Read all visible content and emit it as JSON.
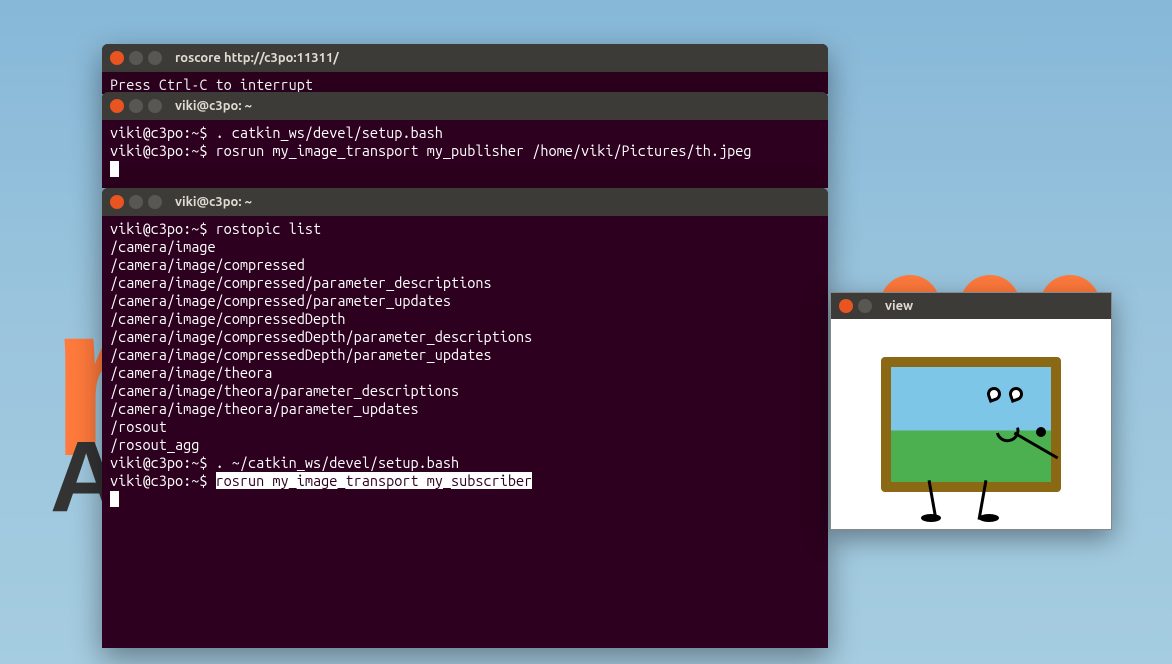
{
  "desktop": {
    "bg_text_top": "r",
    "bg_text_bottom": "A"
  },
  "term1": {
    "title": "roscore http://c3po:11311/",
    "line1": "Press Ctrl-C to interrupt"
  },
  "term2": {
    "title": "viki@c3po: ~",
    "prompt": "viki@c3po:~$ ",
    "line1_cmd": ". catkin_ws/devel/setup.bash",
    "line2_cmd": "rosrun my_image_transport my_publisher /home/viki/Pictures/th.jpeg"
  },
  "term3": {
    "title": "viki@c3po: ~",
    "prompt": "viki@c3po:~$ ",
    "line1_cmd": "rostopic list",
    "topics": [
      "/camera/image",
      "/camera/image/compressed",
      "/camera/image/compressed/parameter_descriptions",
      "/camera/image/compressed/parameter_updates",
      "/camera/image/compressedDepth",
      "/camera/image/compressedDepth/parameter_descriptions",
      "/camera/image/compressedDepth/parameter_updates",
      "/camera/image/theora",
      "/camera/image/theora/parameter_descriptions",
      "/camera/image/theora/parameter_updates",
      "/rosout",
      "/rosout_agg"
    ],
    "line14_cmd": ". ~/catkin_ws/devel/setup.bash",
    "line15_cmd_highlighted": "rosrun my_image_transport my_subscriber"
  },
  "imagewin": {
    "title": "view"
  }
}
